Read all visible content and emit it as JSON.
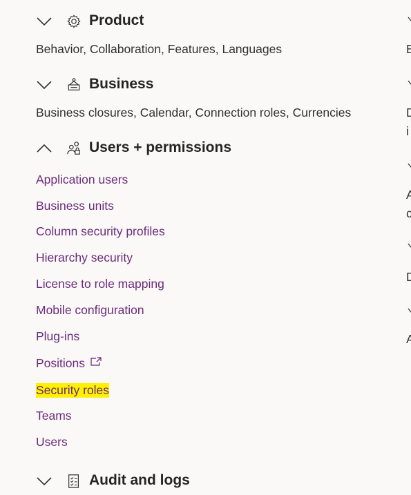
{
  "groups": [
    {
      "title": "Product",
      "icon": "gear-icon",
      "expanded": false,
      "summary": "Behavior, Collaboration, Features, Languages"
    },
    {
      "title": "Business",
      "icon": "business-icon",
      "expanded": false,
      "summary": "Business closures, Calendar, Connection roles, Currencies"
    },
    {
      "title": "Users + permissions",
      "icon": "users-lock-icon",
      "expanded": true,
      "items": [
        {
          "label": "Application users"
        },
        {
          "label": "Business units"
        },
        {
          "label": "Column security profiles"
        },
        {
          "label": "Hierarchy security"
        },
        {
          "label": "License to role mapping"
        },
        {
          "label": "Mobile configuration"
        },
        {
          "label": "Plug-ins"
        },
        {
          "label": "Positions",
          "external": true
        },
        {
          "label": "Security roles",
          "highlighted": true
        },
        {
          "label": "Teams"
        },
        {
          "label": "Users"
        }
      ]
    },
    {
      "title": "Audit and logs",
      "icon": "checklist-icon",
      "expanded": false
    }
  ],
  "right_column_fragments": [
    "E",
    "D",
    "i",
    "A",
    "c",
    "D",
    "A"
  ],
  "colors": {
    "background": "#faf9f8",
    "link": "#6b2c7a",
    "highlight": "#fff100"
  }
}
